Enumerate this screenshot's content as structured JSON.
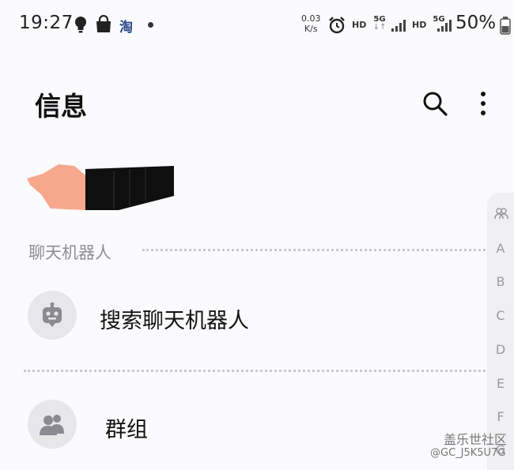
{
  "status_bar": {
    "time": "19:27",
    "taobao_label": "淘",
    "net_speed_value": "0.03",
    "net_speed_unit": "K/s",
    "hd1": "HD",
    "g5_1": "5G",
    "hd2": "HD",
    "g5_2": "5G",
    "battery": "50%"
  },
  "header": {
    "title": "信息"
  },
  "sections": {
    "chatbots_label": "聊天机器人"
  },
  "items": {
    "search_chatbots": "搜索聊天机器人",
    "groups": "群组"
  },
  "index_bar": {
    "letters": [
      "A",
      "B",
      "C",
      "D",
      "E",
      "F",
      "G"
    ]
  },
  "watermark": {
    "line1": "盖乐世社区",
    "line2": "@GC_J5K5U7G"
  }
}
